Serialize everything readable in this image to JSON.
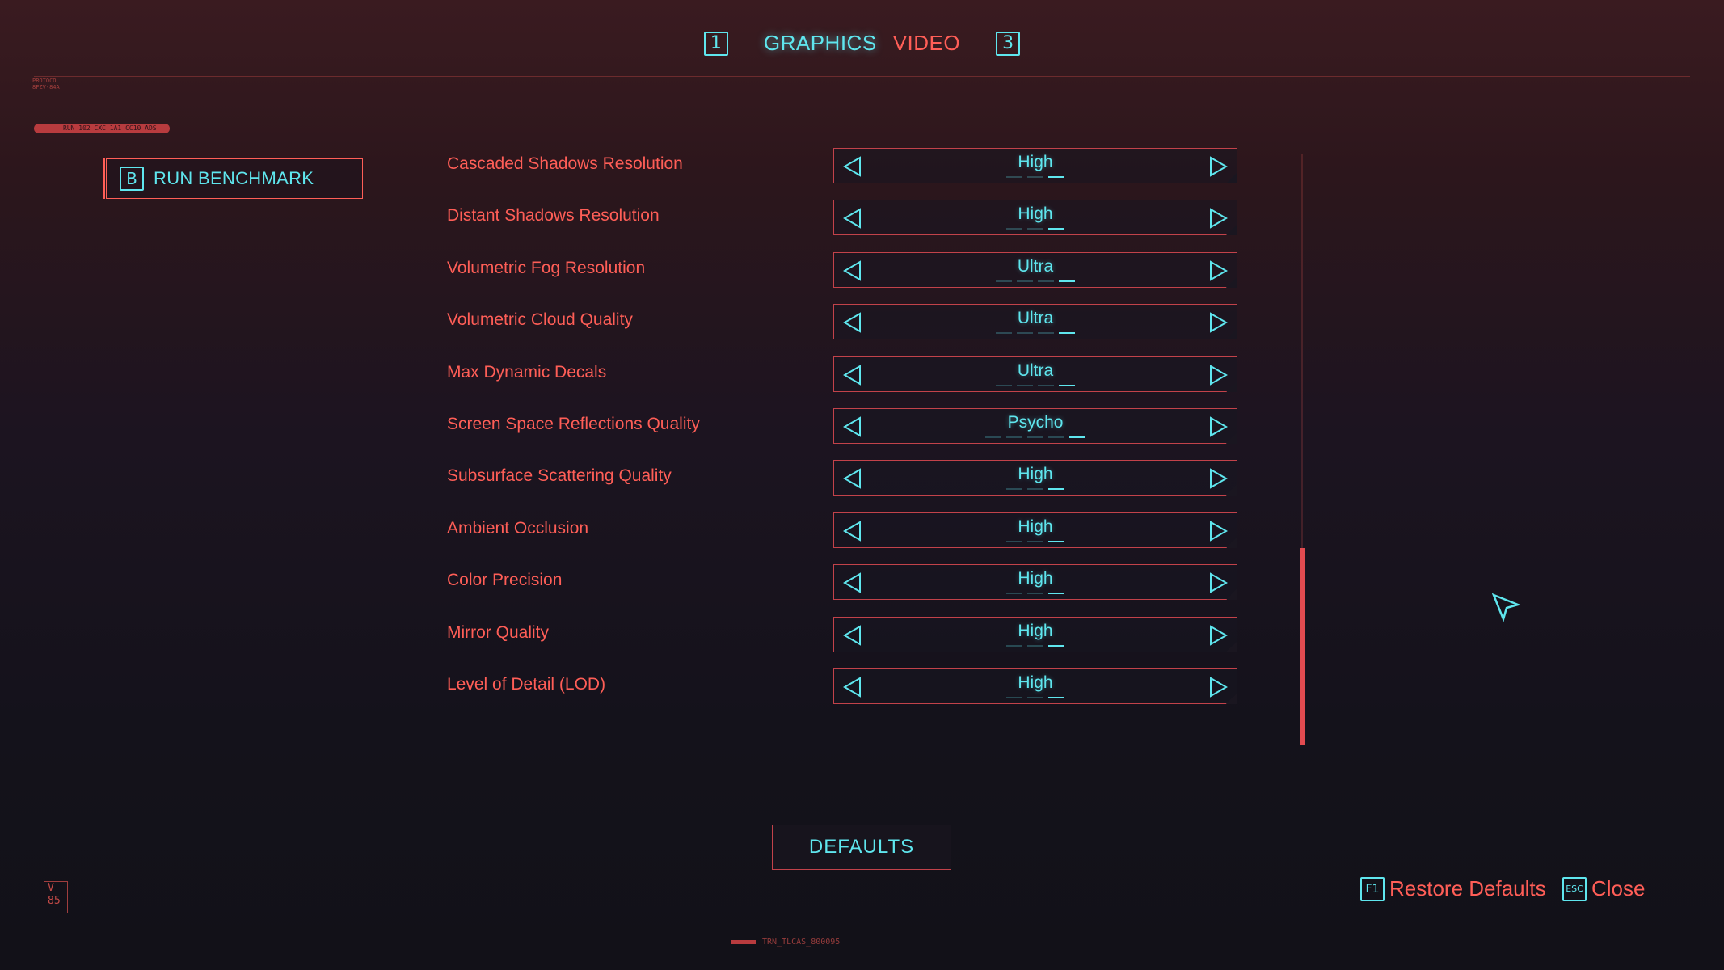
{
  "header": {
    "tab_prev_key": "1",
    "tab_active": "GRAPHICS",
    "tab_inactive": "VIDEO",
    "tab_next_key": "3"
  },
  "sidebar": {
    "benchmark_key": "B",
    "benchmark_label": "RUN BENCHMARK"
  },
  "settings": [
    {
      "label": "Cascaded Shadows Resolution",
      "value": "High"
    },
    {
      "label": "Distant Shadows Resolution",
      "value": "High"
    },
    {
      "label": "Volumetric Fog Resolution",
      "value": "Ultra"
    },
    {
      "label": "Volumetric Cloud Quality",
      "value": "Ultra"
    },
    {
      "label": "Max Dynamic Decals",
      "value": "Ultra"
    },
    {
      "label": "Screen Space Reflections Quality",
      "value": "Psycho"
    },
    {
      "label": "Subsurface Scattering Quality",
      "value": "High"
    },
    {
      "label": "Ambient Occlusion",
      "value": "High"
    },
    {
      "label": "Color Precision",
      "value": "High"
    },
    {
      "label": "Mirror Quality",
      "value": "High"
    },
    {
      "label": "Level of Detail (LOD)",
      "value": "High"
    }
  ],
  "footer": {
    "defaults_label": "DEFAULTS",
    "restore_key": "F1",
    "restore_label": "Restore Defaults",
    "close_key": "ESC",
    "close_label": "Close",
    "barcode_text": "TRN_TLCAS_800095"
  },
  "decor": {
    "protocol_text": "PROTOCOL 8FZV-84A",
    "pill_text": "RUN 102 CXC 1A1 CC10 ADS",
    "version_badge": "V 85"
  },
  "colors": {
    "accent_red": "#ff5e57",
    "accent_cyan": "#5fe6ee",
    "background": "#14121b"
  }
}
